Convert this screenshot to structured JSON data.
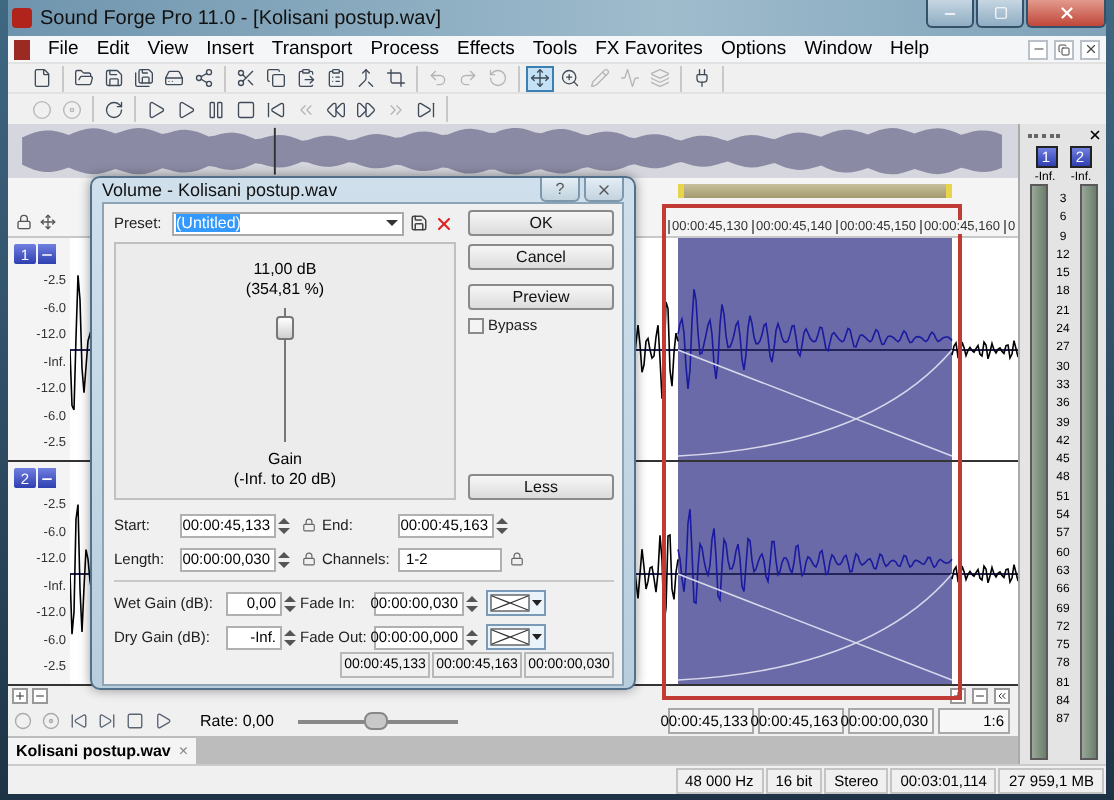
{
  "window": {
    "title": "Sound Forge Pro 11.0 - [Kolisani postup.wav]"
  },
  "menu": [
    "File",
    "Edit",
    "View",
    "Insert",
    "Transport",
    "Process",
    "Effects",
    "Tools",
    "FX Favorites",
    "Options",
    "Window",
    "Help"
  ],
  "toolbars": [
    {
      "groups": [
        [
          {
            "kind": "new",
            "selected": false,
            "disabled": false
          }
        ],
        [
          {
            "kind": "open",
            "selected": false,
            "disabled": false
          },
          {
            "kind": "save",
            "selected": false,
            "disabled": false
          },
          {
            "kind": "save_as",
            "selected": false,
            "disabled": false
          },
          {
            "kind": "render",
            "selected": false,
            "disabled": false
          },
          {
            "kind": "publish",
            "selected": false,
            "disabled": false
          }
        ],
        [
          {
            "kind": "cut",
            "selected": false,
            "disabled": false
          },
          {
            "kind": "copy",
            "selected": false,
            "disabled": false
          },
          {
            "kind": "paste",
            "selected": false,
            "disabled": false
          },
          {
            "kind": "paste_new",
            "selected": false,
            "disabled": false
          },
          {
            "kind": "mix",
            "selected": false,
            "disabled": false
          },
          {
            "kind": "crop",
            "selected": false,
            "disabled": false
          }
        ],
        [
          {
            "kind": "undo",
            "selected": false,
            "disabled": true
          },
          {
            "kind": "redo",
            "selected": false,
            "disabled": true
          },
          {
            "kind": "repeat",
            "selected": false,
            "disabled": true
          }
        ],
        [
          {
            "kind": "edit_tool",
            "selected": true,
            "disabled": false
          },
          {
            "kind": "magnify",
            "selected": false,
            "disabled": false
          },
          {
            "kind": "pencil",
            "selected": false,
            "disabled": true
          },
          {
            "kind": "envelope",
            "selected": false,
            "disabled": true
          },
          {
            "kind": "event",
            "selected": false,
            "disabled": true
          }
        ],
        [
          {
            "kind": "plugin",
            "selected": false,
            "disabled": false
          }
        ]
      ]
    },
    {
      "groups": [
        [
          {
            "kind": "record",
            "selected": false,
            "disabled": true
          },
          {
            "kind": "record_arm",
            "selected": false,
            "disabled": true
          }
        ],
        [
          {
            "kind": "loop",
            "selected": false,
            "disabled": false
          }
        ],
        [
          {
            "kind": "play_all",
            "selected": false,
            "disabled": false
          },
          {
            "kind": "play",
            "selected": false,
            "disabled": false
          },
          {
            "kind": "pause",
            "selected": false,
            "disabled": false
          },
          {
            "kind": "stop",
            "selected": false,
            "disabled": false
          },
          {
            "kind": "start",
            "selected": false,
            "disabled": false
          },
          {
            "kind": "prev_marker",
            "selected": false,
            "disabled": true
          },
          {
            "kind": "rewind",
            "selected": false,
            "disabled": false
          },
          {
            "kind": "forward",
            "selected": false,
            "disabled": false
          },
          {
            "kind": "next_marker",
            "selected": false,
            "disabled": true
          },
          {
            "kind": "end",
            "selected": false,
            "disabled": false
          }
        ]
      ]
    }
  ],
  "timeline": {
    "ticks": [
      "00:00:45,130",
      "00:00:45,140",
      "00:00:45,150",
      "00:00:45,160",
      "0"
    ]
  },
  "channels": [
    {
      "badge": "1",
      "scale": [
        "-2.5",
        "-6.0",
        "-12.0",
        "-Inf.",
        "-12.0",
        "-6.0",
        "-2.5"
      ]
    },
    {
      "badge": "2",
      "scale": [
        "-2.5",
        "-6.0",
        "-12.0",
        "-Inf.",
        "-12.0",
        "-6.0",
        "-2.5"
      ]
    }
  ],
  "selection_times": [
    "00:00:45,133",
    "00:00:45,163",
    "00:00:00,030"
  ],
  "zoom_ratio": "1:6",
  "transport": {
    "items": [
      {
        "kind": "record",
        "disabled": true
      },
      {
        "kind": "record_arm",
        "disabled": true
      },
      {
        "kind": "start",
        "disabled": false
      },
      {
        "kind": "end",
        "disabled": false
      },
      {
        "kind": "stop",
        "disabled": false
      },
      {
        "kind": "play",
        "disabled": false
      }
    ],
    "rate": "Rate: 0,00"
  },
  "document_tab": {
    "label": "Kolisani postup.wav",
    "close": "×"
  },
  "meters": {
    "channels": [
      {
        "badge": "1",
        "peak": "-Inf."
      },
      {
        "badge": "2",
        "peak": "-Inf."
      }
    ],
    "scale": [
      "3",
      "6",
      "9",
      "12",
      "15",
      "18",
      "21",
      "24",
      "27",
      "30",
      "33",
      "36",
      "39",
      "42",
      "45",
      "48",
      "51",
      "54",
      "57",
      "60",
      "63",
      "66",
      "69",
      "72",
      "75",
      "78",
      "81",
      "84",
      "87"
    ]
  },
  "status_bar": [
    "48 000 Hz",
    "16 bit",
    "Stereo",
    "00:03:01,114",
    "27 959,1 MB"
  ],
  "dialog": {
    "title": "Volume - Kolisani postup.wav",
    "help": "?",
    "preset": {
      "label": "Preset:",
      "value": "(Untitled)",
      "highlighted": true
    },
    "gain": {
      "reading": "11,00 dB",
      "percent": "(354,81 %)",
      "label": "Gain",
      "range": "(-Inf. to 20 dB)",
      "level": 0.92
    },
    "ok": "OK",
    "cancel": "Cancel",
    "preview": "Preview",
    "less": "Less",
    "bypass": {
      "label": "Bypass",
      "checked": false
    },
    "start": {
      "label": "Start:",
      "value": "00:00:45,133"
    },
    "end": {
      "label": "End:",
      "value": "00:00:45,163"
    },
    "length": {
      "label": "Length:",
      "value": "00:00:00,030"
    },
    "channels": {
      "label": "Channels:",
      "value": "1-2"
    },
    "wet_gain": {
      "label": "Wet Gain (dB):",
      "value": "0,00"
    },
    "fade_in": {
      "label": "Fade In:",
      "value": "00:00:00,030"
    },
    "dry_gain": {
      "label": "Dry Gain (dB):",
      "value": "-Inf."
    },
    "fade_out": {
      "label": "Fade Out:",
      "value": "00:00:00,000"
    },
    "summary": [
      "00:00:45,133",
      "00:00:45,163",
      "00:00:00,030"
    ]
  }
}
